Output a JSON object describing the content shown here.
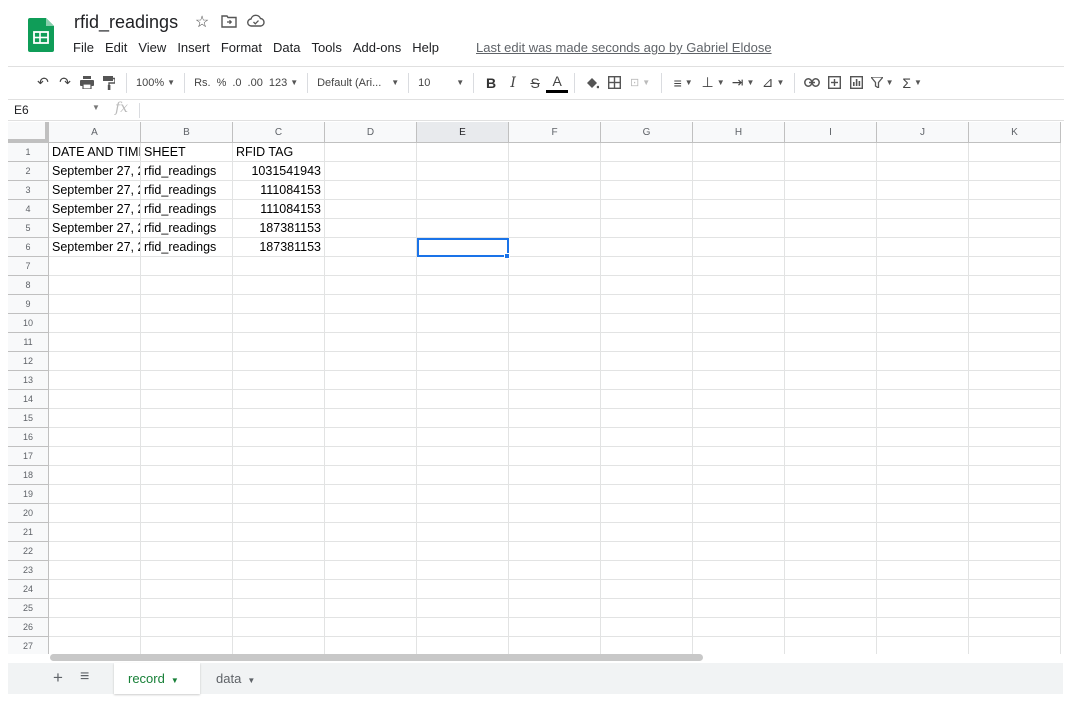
{
  "header": {
    "title": "rfid_readings",
    "star_icon": "star-icon",
    "move_icon": "folder-move-icon",
    "cloud_icon": "cloud-status-icon",
    "menu": [
      "File",
      "Edit",
      "View",
      "Insert",
      "Format",
      "Data",
      "Tools",
      "Add-ons",
      "Help"
    ],
    "last_edit": "Last edit was made seconds ago by Gabriel Eldose",
    "logo_color": "#0f9d58"
  },
  "toolbar": {
    "zoom": "100%",
    "currency": "Rs.",
    "percent": "%",
    "decrease_decimals": ".0",
    "increase_decimals": ".00",
    "more_formats": "123",
    "font": "Default (Ari...",
    "font_size": "10",
    "bold": "B",
    "italic": "I",
    "strikethrough": "S",
    "text_color": "A",
    "sum": "Σ"
  },
  "formula_bar": {
    "cell_ref": "E6",
    "fx": "fx",
    "value": ""
  },
  "grid": {
    "columns": [
      "A",
      "B",
      "C",
      "D",
      "E",
      "F",
      "G",
      "H",
      "I",
      "J",
      "K"
    ],
    "selected_column": "E",
    "row_numbers": [
      "1",
      "2",
      "3",
      "4",
      "5",
      "6",
      "7",
      "8",
      "9",
      "10",
      "11",
      "12",
      "13",
      "14",
      "15",
      "16",
      "17",
      "18",
      "19",
      "20",
      "21",
      "22",
      "23",
      "24",
      "25",
      "26",
      "27"
    ],
    "rows": [
      [
        "DATE AND TIMI",
        "SHEET",
        "RFID TAG"
      ],
      [
        "September 27, 2",
        "rfid_readings",
        "1031541943"
      ],
      [
        "September 27, 2",
        "rfid_readings",
        "111084153"
      ],
      [
        "September 27, 2",
        "rfid_readings",
        "111084153"
      ],
      [
        "September 27, 2",
        "rfid_readings",
        "187381153"
      ],
      [
        "September 27, 2",
        "rfid_readings",
        "187381153"
      ]
    ],
    "selected_cell": "E6",
    "selection_color": "#1a73e8"
  },
  "tabs": {
    "add_icon": "+",
    "list_icon": "≡",
    "items": [
      {
        "label": "record",
        "active": true
      },
      {
        "label": "data",
        "active": false
      }
    ],
    "active_color": "#188038"
  }
}
